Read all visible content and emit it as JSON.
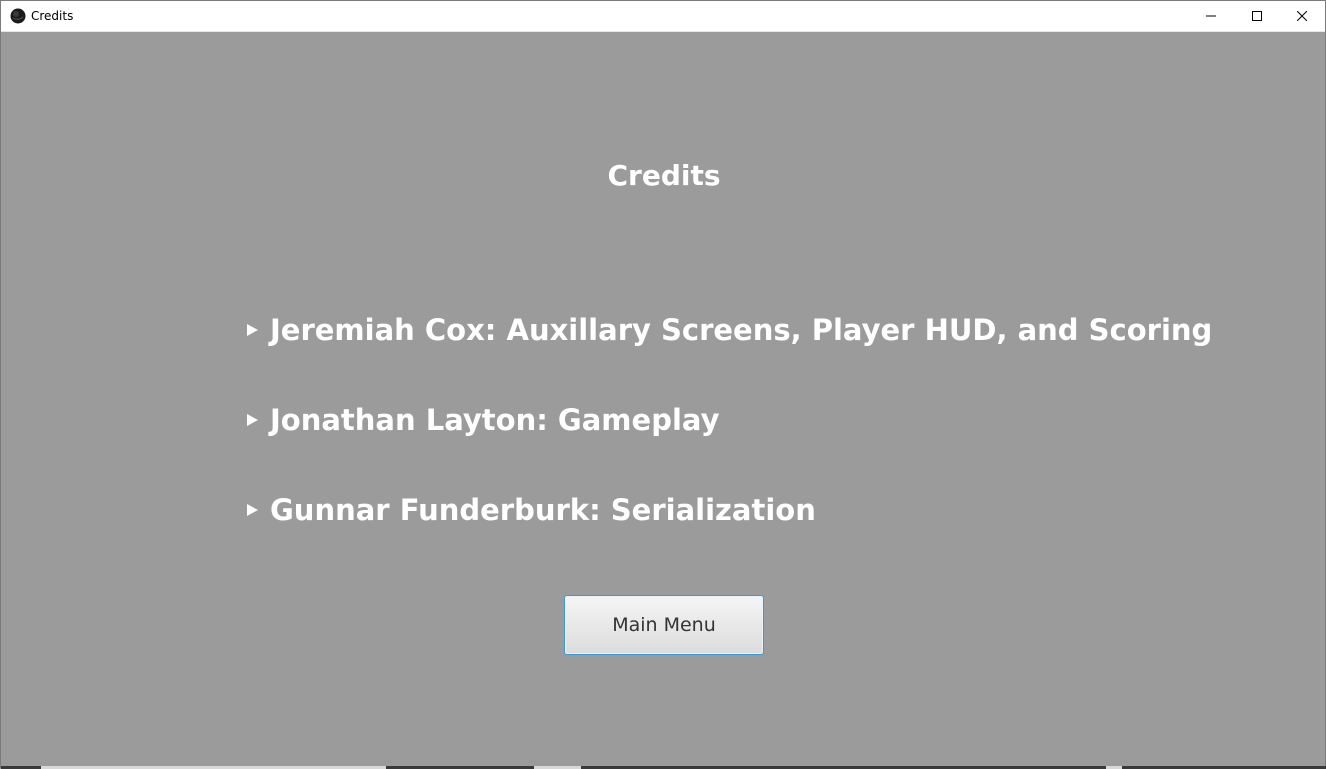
{
  "window": {
    "title": "Credits",
    "icon": "app-globe-icon",
    "controls": {
      "minimize": "minimize-icon",
      "maximize": "maximize-icon",
      "close": "close-icon"
    }
  },
  "screen": {
    "heading": "Credits",
    "credits": [
      {
        "label": "Jeremiah Cox: Auxillary Screens, Player HUD, and Scoring"
      },
      {
        "label": "Jonathan Layton: Gameplay"
      },
      {
        "label": "Gunnar Funderburk: Serialization"
      }
    ],
    "main_menu_label": "Main Menu"
  },
  "colors": {
    "background": "#9b9b9b",
    "text": "#ffffff",
    "button_border": "#3a9ad9"
  }
}
